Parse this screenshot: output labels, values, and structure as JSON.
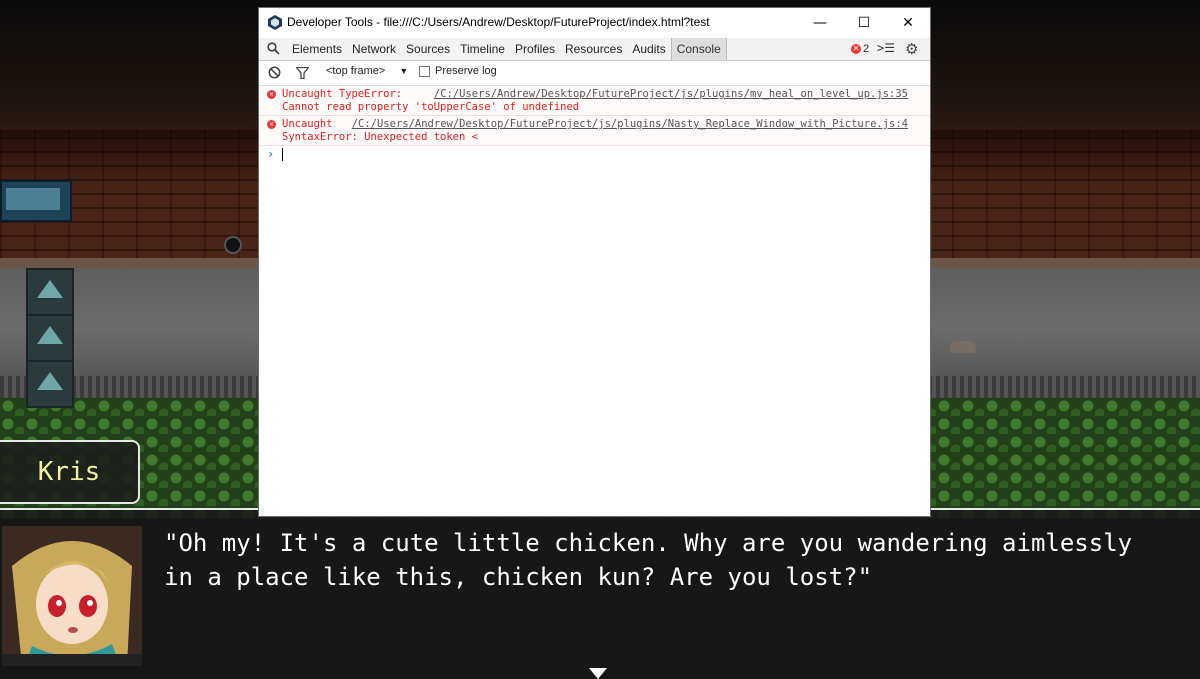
{
  "devtools": {
    "title": "Developer Tools - file:///C:/Users/Andrew/Desktop/FutureProject/index.html?test",
    "window_buttons": {
      "minimize": "—",
      "maximize": "☐",
      "close": "✕"
    },
    "tabs": [
      "Elements",
      "Network",
      "Sources",
      "Timeline",
      "Profiles",
      "Resources",
      "Audits",
      "Console"
    ],
    "active_tab": "Console",
    "error_count": "2",
    "frame_selector": "<top frame>",
    "preserve_log_label": "Preserve log",
    "console_messages": [
      {
        "line1": "Uncaught TypeError:",
        "source": "/C:/Users/Andrew/Desktop/FutureProject/js/plugins/mv_heal_on_level_up.js:35",
        "line2": "Cannot read property 'toUpperCase' of undefined"
      },
      {
        "line1": "Uncaught",
        "source": "/C:/Users/Andrew/Desktop/FutureProject/js/plugins/Nasty_Replace_Window_with_Picture.js:4",
        "line2": "SyntaxError: Unexpected token <"
      }
    ],
    "prompt_symbol": "›"
  },
  "game": {
    "speaker_name": "Kris",
    "message": "\"Oh my! It's a cute little chicken. Why are you wandering aimlessly\nin a place like this, chicken kun? Are you lost?\""
  }
}
